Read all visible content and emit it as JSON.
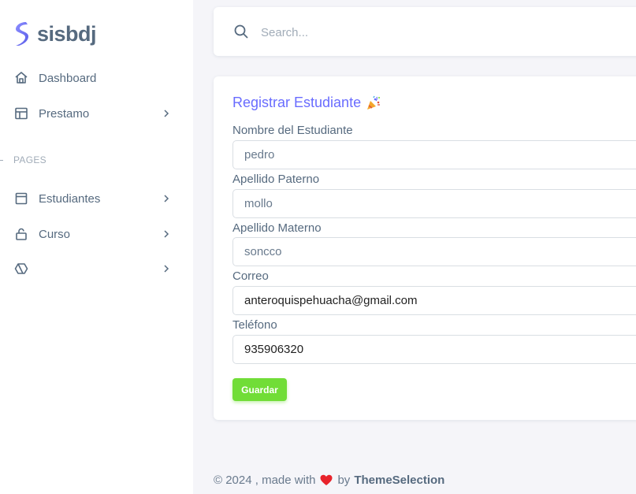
{
  "app": {
    "name": "sisbdj"
  },
  "sidebar": {
    "items": [
      {
        "label": "Dashboard",
        "icon": "home-icon"
      },
      {
        "label": "Prestamo",
        "icon": "layout-icon"
      }
    ],
    "section_header": "PAGES",
    "pages": [
      {
        "label": "Estudiantes",
        "icon": "window-icon"
      },
      {
        "label": "Curso",
        "icon": "lock-icon"
      },
      {
        "label": "",
        "icon": "cube-icon"
      }
    ]
  },
  "search": {
    "placeholder": "Search..."
  },
  "form": {
    "title": "Registrar Estudiante",
    "fields": [
      {
        "label": "Nombre del Estudiante",
        "value": "pedro"
      },
      {
        "label": "Apellido Paterno",
        "value": "mollo"
      },
      {
        "label": "Apellido Materno",
        "value": "soncco"
      },
      {
        "label": "Correo",
        "value": "anteroquispehuacha@gmail.com"
      },
      {
        "label": "Teléfono",
        "value": "935906320"
      }
    ],
    "submit_label": "Guardar"
  },
  "footer": {
    "prefix": "© 2024 , made with",
    "by": "by",
    "brand": "ThemeSelection"
  },
  "colors": {
    "primary": "#696cff",
    "success": "#71dd37",
    "text": "#566a7f",
    "muted": "#a1acb8",
    "heart": "#ff3e1d"
  }
}
